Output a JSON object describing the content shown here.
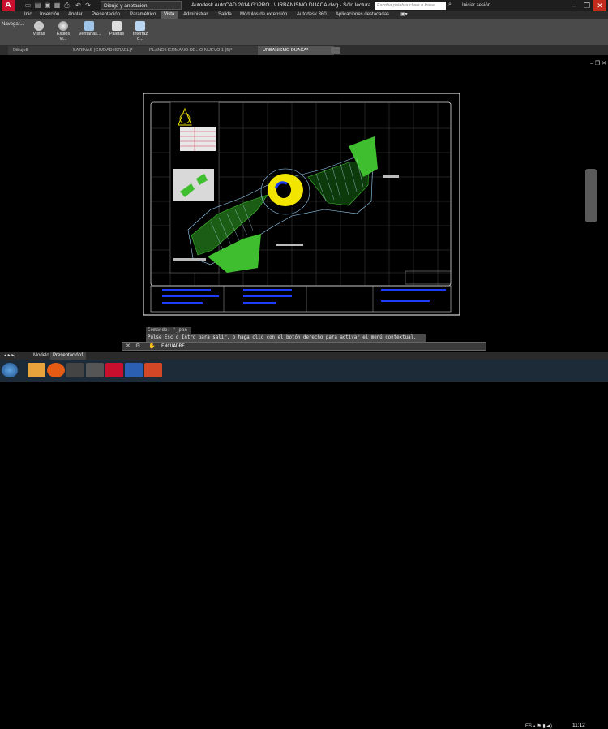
{
  "app": {
    "logo": "A",
    "workspace": "Dibujo y anotación",
    "title": "Autodesk AutoCAD 2014    G:\\PRO...\\URBANISMO DUACA.dwg - Sólo lectura",
    "search_placeholder": "Escriba palabra clave o frase",
    "signin": "Iniciar sesión"
  },
  "ribbon_tabs": [
    "Inic",
    "Inserción",
    "Anotar",
    "Presentación",
    "Paramétrico",
    "Vista",
    "Administrar",
    "Salida",
    "Módulos de extensión",
    "Autodesk 360",
    "Aplicaciones destacadas"
  ],
  "active_tab": "Vista",
  "ribbon": {
    "nav_label": "Navegar...",
    "buttons": [
      "Vistas",
      "Estilos vi...",
      "Ventanas...",
      "Paletas",
      "Interfaz d..."
    ]
  },
  "doc_tabs": [
    "Dibujo8",
    "BARINAS (CIUDAD ISRAEL)*",
    "PLANO HERMANO DE...O NUEVO 1 (5)*",
    "URBANISMO DUACA*"
  ],
  "active_doc": "URBANISMO DUACA*",
  "command": {
    "history_1": "Comando: '_pan",
    "history_2": "Pulse Esc o Intro para salir, o haga clic con el botón derecho para activar el menú contextual.",
    "current": "ENCUADRE"
  },
  "layout_tabs": [
    "Modelo",
    "Presentación1"
  ],
  "active_layout": "Presentación1",
  "taskbar": {
    "lang": "ES",
    "time": "11:12"
  },
  "colors": {
    "accent_red": "#c8102e",
    "drawing_green": "#3fbf2f",
    "drawing_yellow": "#f2e600",
    "drawing_blue": "#1e3cff"
  }
}
